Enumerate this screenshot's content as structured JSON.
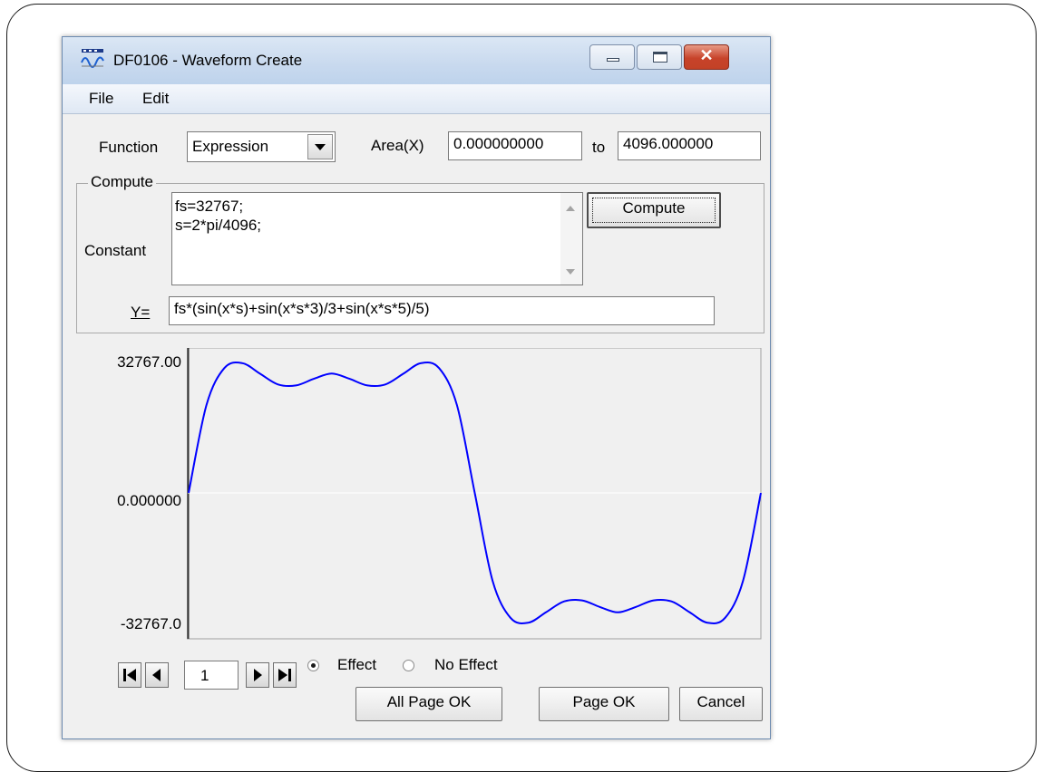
{
  "window": {
    "title": "DF0106 - Waveform Create"
  },
  "menu": {
    "file": "File",
    "edit": "Edit"
  },
  "form": {
    "function_label": "Function",
    "function_value": "Expression",
    "area_label": "Area(X)",
    "area_from": "0.000000000",
    "to_label": "to",
    "area_to": "4096.000000"
  },
  "compute": {
    "group_title": "Compute",
    "constant_label": "Constant",
    "constant_lines": [
      "fs=32767;",
      "s=2*pi/4096;"
    ],
    "compute_button": "Compute",
    "y_label": "Y=",
    "y_expression": "fs*(sin(x*s)+sin(x*s*3)/3+sin(x*s*5)/5)"
  },
  "chart_data": {
    "type": "line",
    "x_range": [
      0,
      4096
    ],
    "ylim": [
      -32767,
      32767
    ],
    "y_tick_labels": [
      "32767.00",
      "0.000000",
      "-32767.0"
    ],
    "series": [
      {
        "color": "#0000ff",
        "x": [
          0,
          128,
          256,
          384,
          512,
          640,
          768,
          896,
          1024,
          1152,
          1280,
          1408,
          1536,
          1664,
          1792,
          1920,
          2048,
          2176,
          2304,
          2432,
          2560,
          2688,
          2816,
          2944,
          3072,
          3200,
          3328,
          3456,
          3584,
          3712,
          3840,
          3968,
          4096
        ],
        "y": [
          0,
          21063,
          29898,
          31085,
          28526,
          25975,
          25740,
          27312,
          28592,
          27312,
          25740,
          25975,
          28526,
          31085,
          29898,
          21063,
          0,
          -21063,
          -29898,
          -31085,
          -28526,
          -25975,
          -25740,
          -27312,
          -28592,
          -27312,
          -25740,
          -25975,
          -28526,
          -31085,
          -29898,
          -21063,
          0
        ]
      }
    ],
    "grid": false
  },
  "pager": {
    "page": "1",
    "effect": "Effect",
    "no_effect": "No Effect",
    "effect_selected": true
  },
  "buttons": {
    "all_page_ok": "All Page OK",
    "page_ok": "Page OK",
    "cancel": "Cancel"
  }
}
